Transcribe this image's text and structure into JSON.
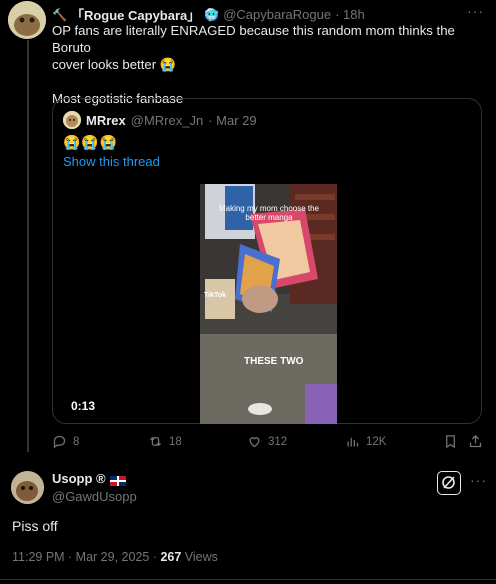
{
  "tweet": {
    "display_name": "「Rogue Capybara」",
    "handle": "@CapybaraRogue",
    "time": "· 18h",
    "text_line1": "OP fans are literally ENRAGED because this random mom thinks the Boruto",
    "text_line2": "cover looks better 😭",
    "text_line3": "Most egotistic fanbase",
    "more": "···"
  },
  "quote": {
    "display_name": "MRrex",
    "handle": "@MRrex_Jn",
    "time": "· Mar 29",
    "emojis": "😭😭😭",
    "show_thread": "Show this thread",
    "video_caption_top": "Making my mom choose the better manga",
    "video_caption_bottom": "THESE TWO",
    "watermark": "TikTok",
    "duration": "0:13"
  },
  "actions": {
    "replies": "8",
    "reposts": "18",
    "likes": "312",
    "views": "12K"
  },
  "reply": {
    "display_name": "Usopp ®",
    "handle": "@GawdUsopp",
    "text": "Piss off",
    "timestamp": "11:29 PM · Mar 29, 2025 · ",
    "views_count": "267",
    "views_label": " Views",
    "more": "···"
  },
  "colors": {
    "accent": "#1d9bf0",
    "muted": "#71767b",
    "text": "#e7e9ea",
    "background": "#000000"
  }
}
